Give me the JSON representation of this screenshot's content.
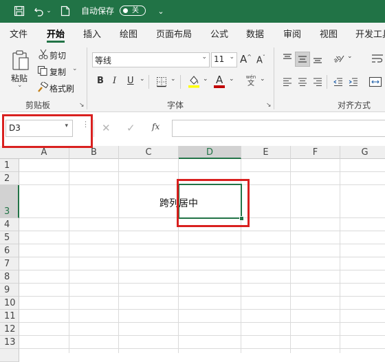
{
  "title_bar": {
    "autosave_label": "自动保存",
    "autosave_state": "关",
    "icons": [
      "save-icon",
      "undo-icon",
      "new-file-icon",
      "customize-qat-icon"
    ]
  },
  "ribbon_tabs": [
    "文件",
    "开始",
    "插入",
    "绘图",
    "页面布局",
    "公式",
    "数据",
    "审阅",
    "视图",
    "开发工具"
  ],
  "active_tab": "开始",
  "ribbon": {
    "clipboard": {
      "paste": "粘贴",
      "cut": "剪切",
      "copy": "复制",
      "format_painter": "格式刷",
      "group_label": "剪贴板"
    },
    "font": {
      "font_name": "等线",
      "font_size": "11",
      "bold": "B",
      "italic": "I",
      "underline": "U",
      "phonetic_top": "wén",
      "phonetic_bottom": "文",
      "font_color_letter": "A",
      "group_label": "字体"
    },
    "alignment": {
      "group_label": "对齐方式"
    }
  },
  "formula_bar": {
    "name_box": "D3",
    "fx": "fx",
    "formula": ""
  },
  "grid": {
    "columns": [
      "A",
      "B",
      "C",
      "D",
      "E",
      "F",
      "G"
    ],
    "rows": [
      "1",
      "2",
      "3",
      "4",
      "5",
      "6",
      "7",
      "8",
      "9",
      "10",
      "11",
      "12",
      "13"
    ],
    "selected_cell": "D3",
    "cell_text": "跨列居中"
  },
  "colors": {
    "accent": "#217346",
    "highlight_box": "#d9201f",
    "font_color_bar": "#c00000",
    "fill_color_bar": "#ffff00"
  }
}
